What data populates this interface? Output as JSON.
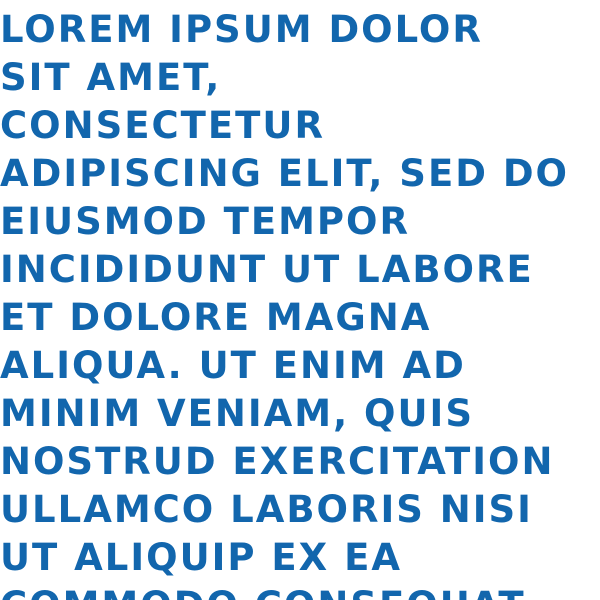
{
  "colors": {
    "text": "#1266ad",
    "background": "#ffffff"
  },
  "lines": [
    "LOREM IPSUM DOLOR",
    "SIT AMET,",
    "CONSECTETUR",
    "ADIPISCING ELIT, SED DO",
    "EIUSMOD TEMPOR",
    "INCIDIDUNT UT LABORE",
    "ET DOLORE MAGNA",
    "ALIQUA. UT ENIM AD",
    "MINIM VENIAM, QUIS",
    "NOSTRUD EXERCITATION",
    "ULLAMCO LABORIS NISI",
    "UT ALIQUIP EX EA",
    "COMMODO CONSEQUAT"
  ]
}
